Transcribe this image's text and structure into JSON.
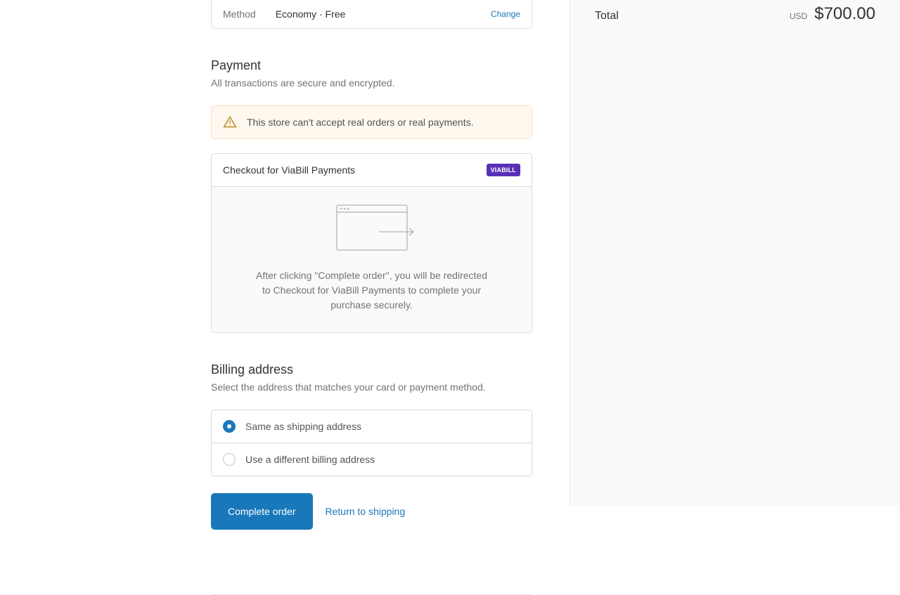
{
  "summary": {
    "method_label": "Method",
    "method_value": "Economy · Free",
    "change": "Change"
  },
  "payment": {
    "heading": "Payment",
    "subtext": "All transactions are secure and encrypted.",
    "warning": "This store can't accept real orders or real payments.",
    "provider_title": "Checkout for ViaBill Payments",
    "provider_badge": "VIABILL",
    "redirect_text": "After clicking \"Complete order\", you will be redirected to Checkout for ViaBill Payments to complete your purchase securely."
  },
  "billing": {
    "heading": "Billing address",
    "subtext": "Select the address that matches your card or payment method.",
    "same_label": "Same as shipping address",
    "different_label": "Use a different billing address",
    "selected": "same"
  },
  "actions": {
    "complete": "Complete order",
    "return": "Return to shipping"
  },
  "order": {
    "total_label": "Total",
    "currency": "USD",
    "total_amount": "$700.00"
  },
  "colors": {
    "accent": "#1878b9",
    "warning_bg": "#fff8ee"
  }
}
